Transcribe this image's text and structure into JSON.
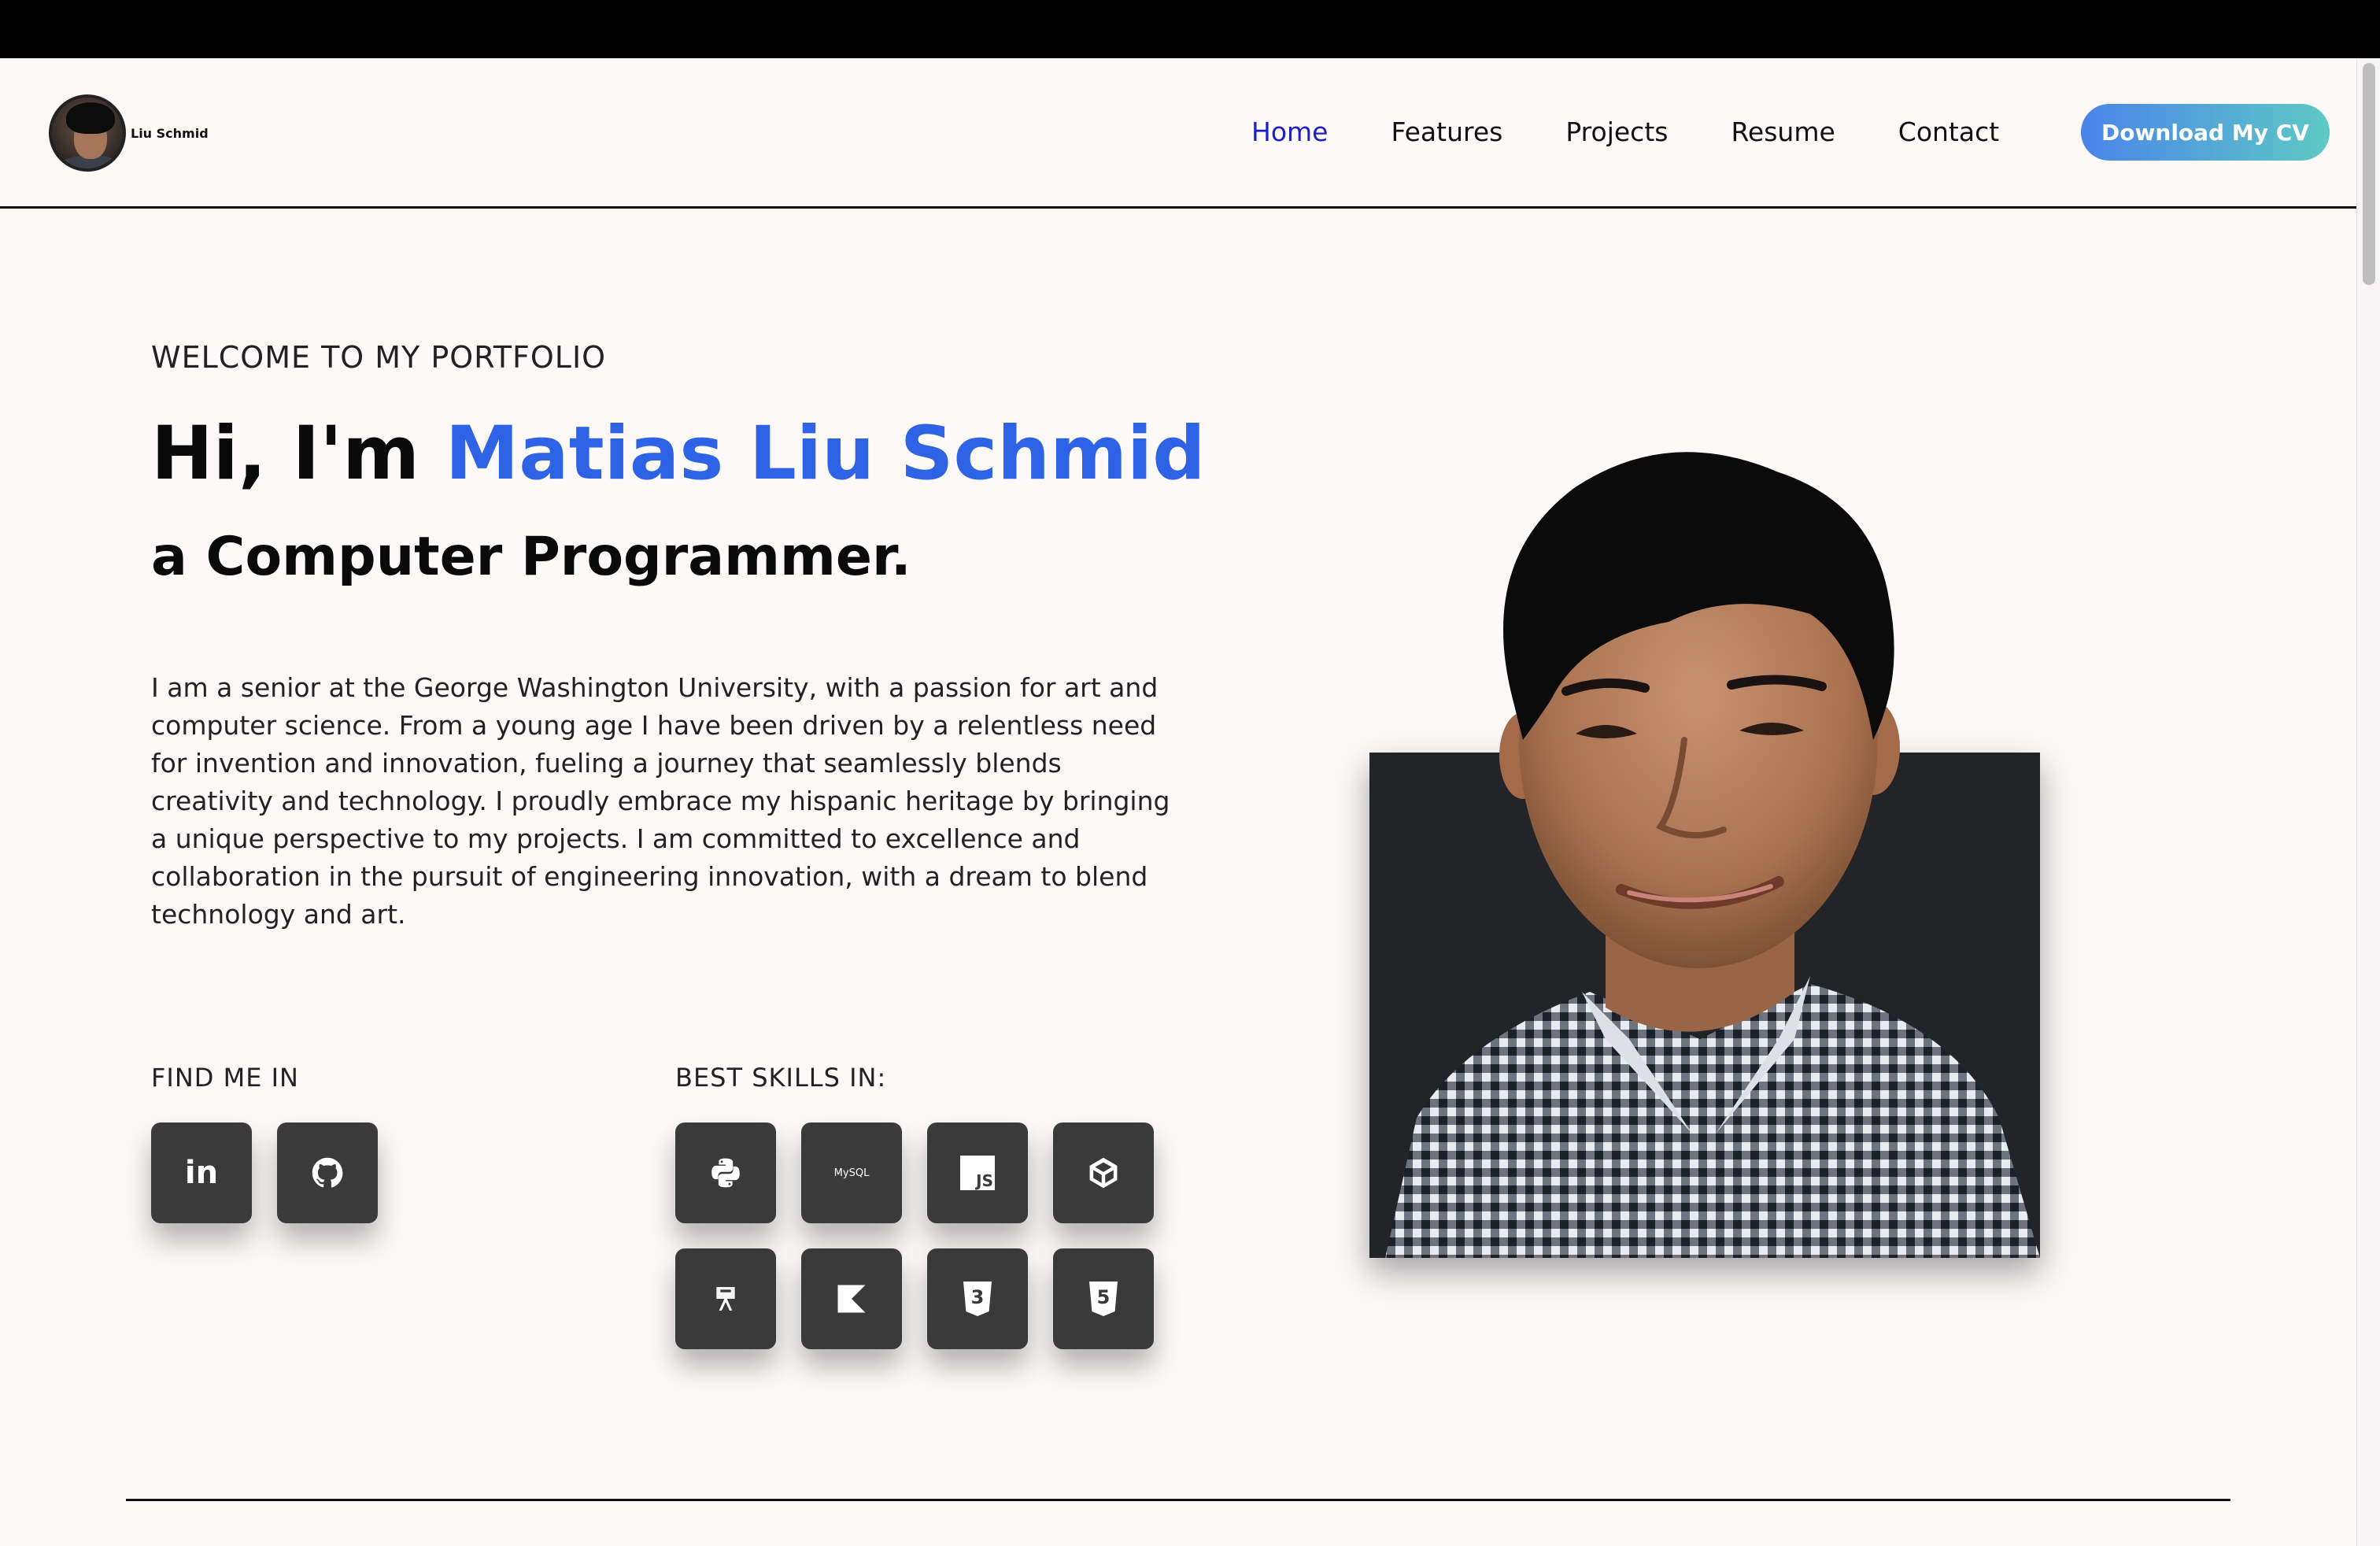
{
  "brand": {
    "name": "Liu Schmid"
  },
  "nav": {
    "items": [
      "Home",
      "Features",
      "Projects",
      "Resume",
      "Contact"
    ],
    "cv_label": "Download My CV"
  },
  "hero": {
    "welcome": "WELCOME TO MY PORTFOLIO",
    "greeting": "Hi, I'm ",
    "name": "Matias Liu Schmid",
    "role": "a Computer Programmer.",
    "bio": "I am a senior at the George Washington University, with a passion for art and computer science. From a young age I have been driven by a relentless need for invention and innovation, fueling a journey that seamlessly blends creativity and technology. I proudly embrace my hispanic heritage by bringing a unique perspective to my projects. I am committed to excellence and collaboration in the pursuit of engineering innovation, with a dream to blend technology and art."
  },
  "social": {
    "label": "FIND ME IN",
    "items": [
      {
        "icon": "linkedin-icon",
        "text": "in"
      },
      {
        "icon": "github-icon"
      }
    ]
  },
  "skills": {
    "label": "BEST SKILLS IN:",
    "items": [
      {
        "icon": "python-icon"
      },
      {
        "icon": "mysql-icon",
        "text": "MySQL"
      },
      {
        "icon": "javascript-icon",
        "text": "JS"
      },
      {
        "icon": "unity-icon"
      },
      {
        "icon": "android-studio-icon"
      },
      {
        "icon": "kotlin-icon"
      },
      {
        "icon": "css3-icon",
        "text": "3"
      },
      {
        "icon": "html5-icon",
        "text": "5"
      }
    ]
  },
  "colors": {
    "accent": "#2e63e6",
    "nav_active": "#1b1fc4",
    "tile": "#3a3a3a",
    "button_gradient": [
      "#4a84ea",
      "#5ec9c4"
    ]
  }
}
